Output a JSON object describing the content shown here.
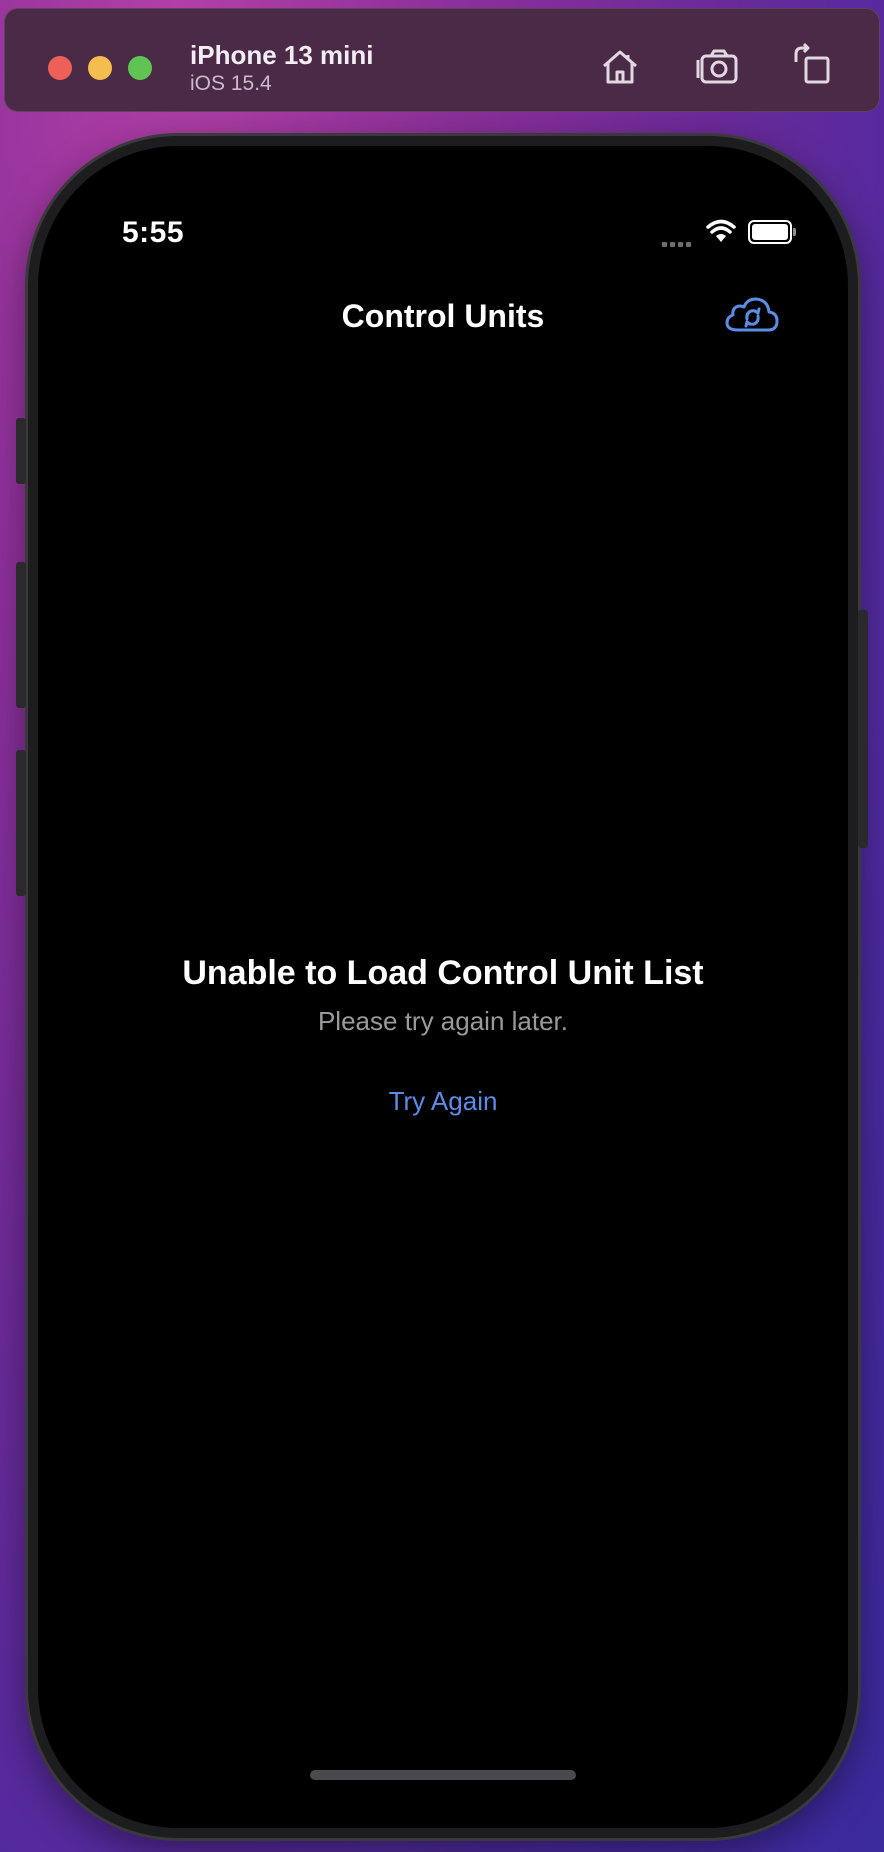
{
  "simulator": {
    "device_name": "iPhone 13 mini",
    "os_version": "iOS 15.4",
    "toolbar_icons": [
      "home-icon",
      "screenshot-icon",
      "rotate-icon"
    ]
  },
  "status_bar": {
    "time": "5:55"
  },
  "nav": {
    "title": "Control Units",
    "right_icon": "cloud-refresh-icon"
  },
  "error": {
    "title": "Unable to Load Control Unit List",
    "message": "Please try again later.",
    "retry_label": "Try Again"
  },
  "colors": {
    "accent": "#5b8de6",
    "background": "#000000"
  }
}
